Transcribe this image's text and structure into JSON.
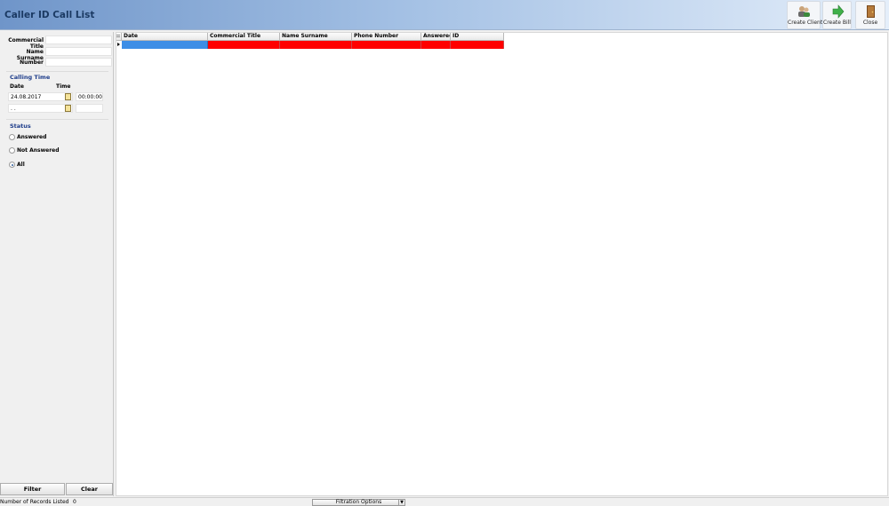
{
  "header": {
    "title": "Caller ID Call List",
    "buttons": [
      {
        "label": "Create Client",
        "icon": "create-client-icon"
      },
      {
        "label": "Create Bill",
        "icon": "create-bill-icon"
      },
      {
        "label": "Close",
        "icon": "close-door-icon"
      }
    ]
  },
  "filter": {
    "commercial_title_label": "Commercial Title",
    "commercial_title_value": "",
    "name_surname_label": "Name Surname",
    "name_surname_value": "",
    "number_label": "Number",
    "number_value": "",
    "calling_time_label": "Calling Time",
    "date_label": "Date",
    "time_label": "Time",
    "start_date": "24.08.2017",
    "start_time": "00:00:00",
    "end_date": " . .",
    "end_time": "",
    "status_label": "Status",
    "status_options": [
      {
        "label": "Answered",
        "selected": false
      },
      {
        "label": "Not Answered",
        "selected": false
      },
      {
        "label": "All",
        "selected": true
      }
    ],
    "filter_button": "Filter",
    "clear_button": "Clear"
  },
  "grid": {
    "columns": [
      "Date",
      "Commercial Title",
      "Name Surname",
      "Phone Number",
      "Answered",
      "ID"
    ],
    "row_colors": {
      "selected": "#3d8ee6",
      "row": "#ff0000"
    }
  },
  "status_bar": {
    "records_label": "Number of Records Listed",
    "records_count": "0",
    "filtration_options": "Filtration Options"
  }
}
